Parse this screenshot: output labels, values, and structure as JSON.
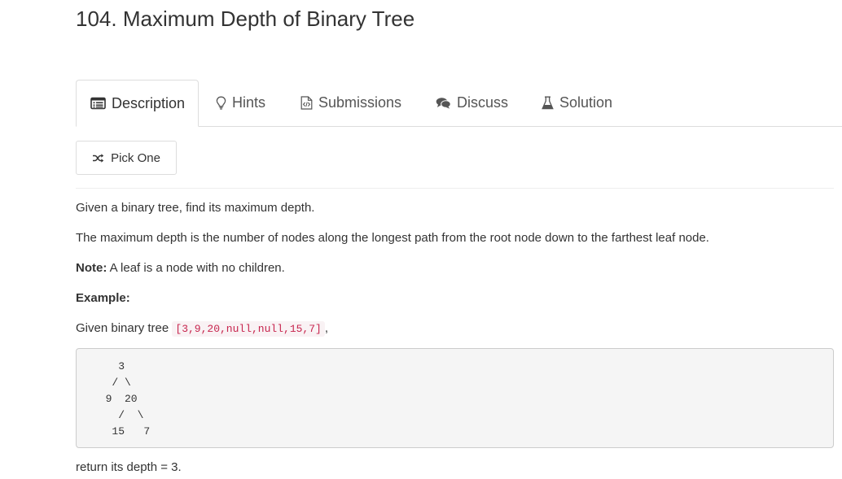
{
  "problem": {
    "title": "104. Maximum Depth of Binary Tree"
  },
  "tabs": [
    {
      "label": "Description",
      "icon": "description-icon",
      "active": true
    },
    {
      "label": "Hints",
      "icon": "lightbulb-icon",
      "active": false
    },
    {
      "label": "Submissions",
      "icon": "code-file-icon",
      "active": false
    },
    {
      "label": "Discuss",
      "icon": "comments-icon",
      "active": false
    },
    {
      "label": "Solution",
      "icon": "flask-icon",
      "active": false
    }
  ],
  "pick_button": {
    "label": "Pick One",
    "icon": "shuffle-icon"
  },
  "content": {
    "intro": "Given a binary tree, find its maximum depth.",
    "definition": "The maximum depth is the number of nodes along the longest path from the root node down to the farthest leaf node.",
    "note_label": "Note:",
    "note_text": " A leaf is a node with no children.",
    "example_label": "Example:",
    "given_prefix": "Given binary tree ",
    "given_code": "[3,9,20,null,null,15,7]",
    "given_suffix": ",",
    "tree_lines": [
      "    3",
      "   / \\",
      "  9  20",
      "    /  \\",
      "   15   7"
    ],
    "return_text": "return its depth = 3."
  }
}
